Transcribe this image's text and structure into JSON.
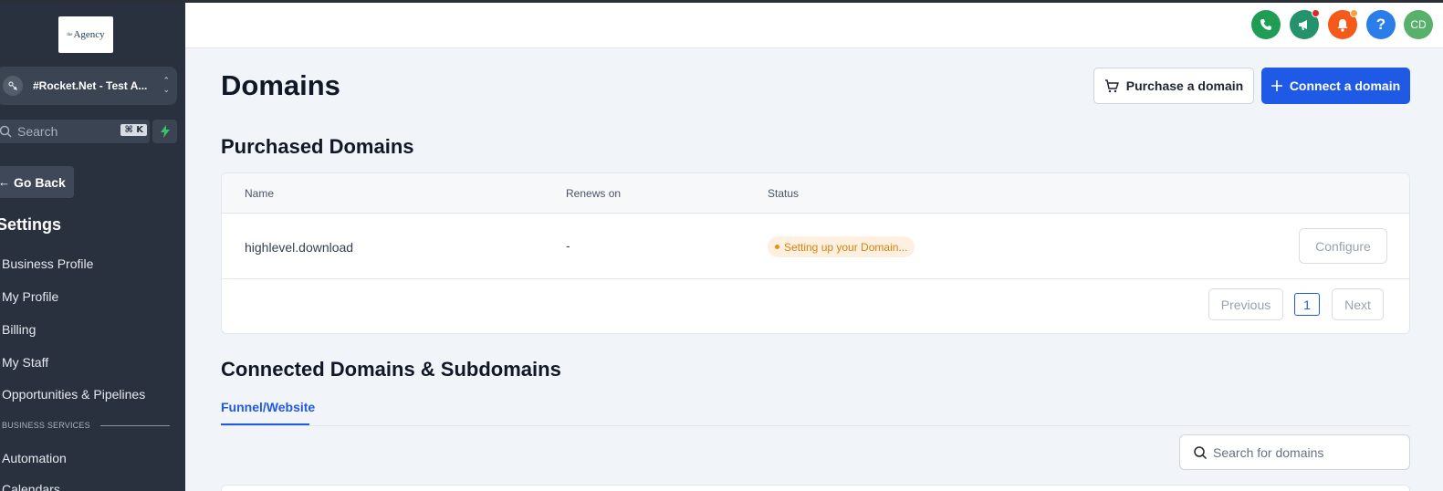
{
  "sidebar": {
    "logo_text": "Agency",
    "account_name": "#Rocket.Net - Test A...",
    "search_placeholder": "Search",
    "search_shortcut": "⌘ K",
    "go_back": "Go Back",
    "settings_heading": "Settings",
    "items": [
      {
        "label": "Business Profile"
      },
      {
        "label": "My Profile"
      },
      {
        "label": "Billing"
      },
      {
        "label": "My Staff"
      },
      {
        "label": "Opportunities & Pipelines"
      }
    ],
    "section_label": "BUSINESS SERVICES",
    "items2": [
      {
        "label": "Automation"
      },
      {
        "label": "Calendars"
      }
    ]
  },
  "header": {
    "icons": [
      {
        "name": "phone-icon",
        "color": "#1f9d55"
      },
      {
        "name": "megaphone-icon",
        "color": "#23936b",
        "badge": "#e5242a"
      },
      {
        "name": "bell-icon",
        "color": "#f55a1b",
        "badge": "#f4a23a"
      },
      {
        "name": "help-icon",
        "color": "#2b7de9",
        "text": "?"
      },
      {
        "name": "avatar",
        "color": "#58b16a",
        "text": "CD"
      }
    ]
  },
  "main": {
    "title": "Domains",
    "purchase_button": "Purchase a domain",
    "connect_button": "Connect a domain",
    "purchased_heading": "Purchased Domains",
    "table": {
      "columns": [
        "Name",
        "Renews on",
        "Status"
      ],
      "rows": [
        {
          "name": "highlevel.download",
          "renews_on": "-",
          "status": "Setting up your Domain...",
          "action": "Configure"
        }
      ]
    },
    "pagination": {
      "previous": "Previous",
      "page": "1",
      "next": "Next"
    },
    "connected_heading": "Connected Domains & Subdomains",
    "tabs": [
      {
        "label": "Funnel/Website",
        "active": true
      }
    ],
    "domain_search_placeholder": "Search for domains"
  },
  "colors": {
    "accent": "#1f5ae6",
    "sidebar_bg": "#29313f",
    "status_pending": "#d9830b"
  }
}
